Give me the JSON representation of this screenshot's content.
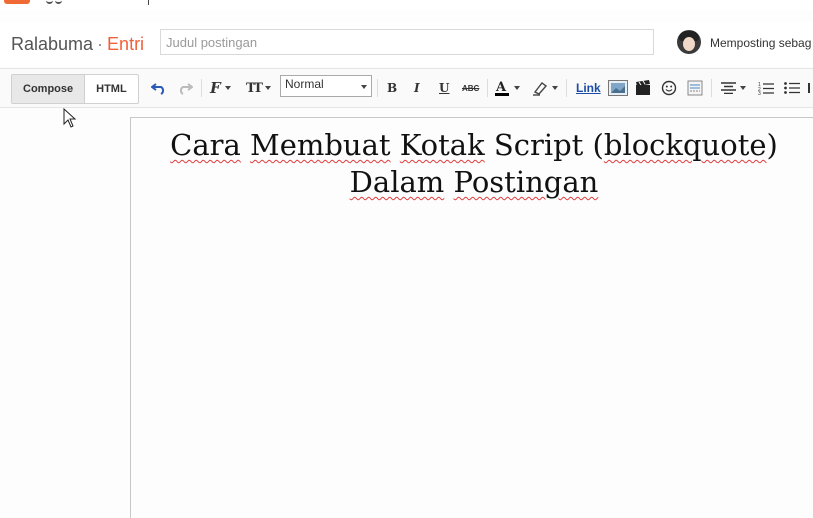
{
  "header": {
    "blog_name": "Ralabuma",
    "separator": "·",
    "section": "Entri",
    "title_placeholder": "Judul postingan",
    "posting_as": "Memposting sebag"
  },
  "toolbar": {
    "compose_label": "Compose",
    "html_label": "HTML",
    "format_value": "Normal",
    "link_label": "Link",
    "bold_label": "B",
    "italic_label": "I",
    "underline_label": "U",
    "strike_label": "ABC",
    "font_label": "F",
    "size_label": "TT"
  },
  "editor": {
    "line1_words": [
      "Cara",
      " ",
      "Membuat",
      " ",
      "Kotak",
      " Script (",
      "blockquote",
      ")"
    ],
    "line2_words": [
      "Dalam",
      " ",
      "Postingan"
    ]
  },
  "colors": {
    "accent": "#f2603a",
    "link": "#1a4ca8",
    "spellcheck": "#e03c3c"
  },
  "icons": [
    "undo-icon",
    "redo-icon",
    "font-icon",
    "font-size-icon",
    "text-color-icon",
    "highlight-icon",
    "image-icon",
    "video-icon",
    "emoji-icon",
    "jump-break-icon",
    "align-icon",
    "numbered-list-icon",
    "bullet-list-icon"
  ]
}
